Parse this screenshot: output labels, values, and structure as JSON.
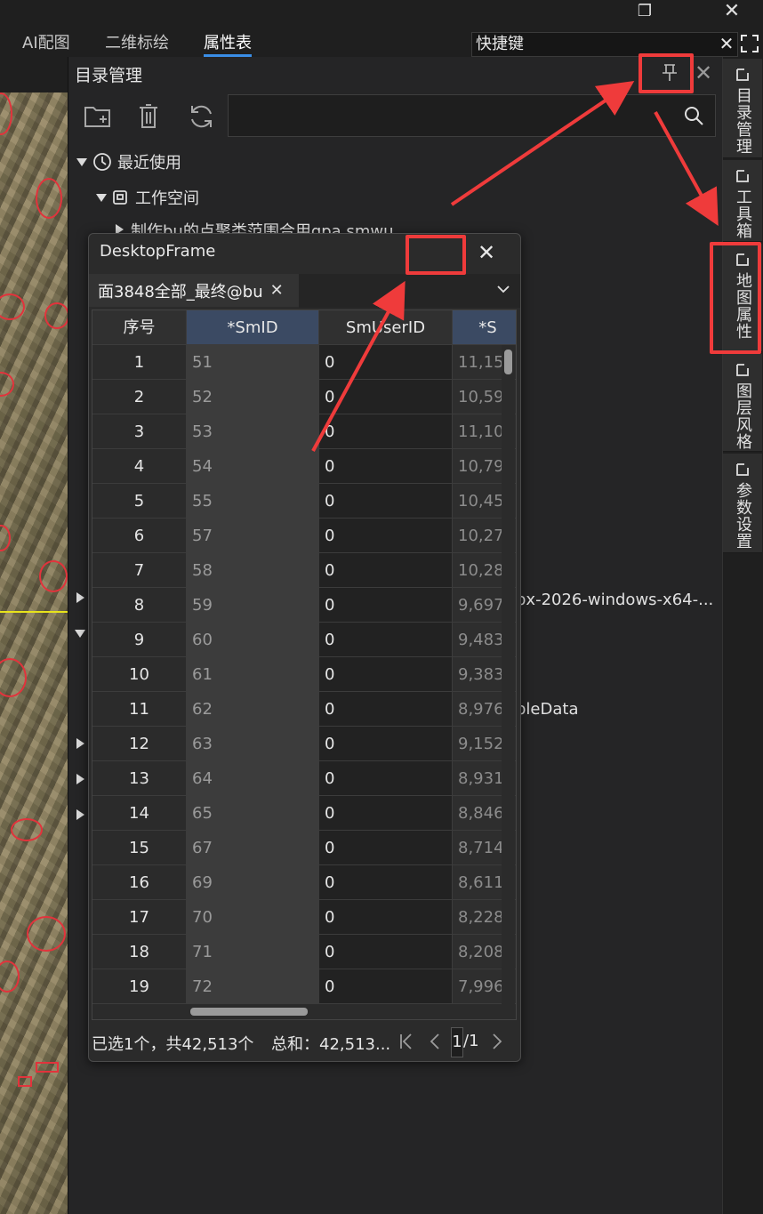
{
  "ribbon": {
    "tabs": [
      "AI配图",
      "二维标绘",
      "属性表"
    ],
    "active_tab": "属性表",
    "shortcut_value": "快捷键",
    "clear_glyph": "✕"
  },
  "window_controls": {
    "restore": "❐",
    "close": "✕"
  },
  "catalog": {
    "title": "目录管理",
    "pin_glyph": "⊤",
    "close_glyph": "✕",
    "tree": [
      {
        "label": "最近使用"
      },
      {
        "label": "工作空间"
      },
      {
        "label": "制作bu的点聚类范围合用gpa.smwu"
      },
      {
        "label": "px-2026-windows-x64-..."
      },
      {
        "label": "bleData"
      }
    ]
  },
  "dock": {
    "tabs": [
      "目录管理",
      "工具箱",
      "地图属性",
      "图层风格",
      "参数设置"
    ]
  },
  "frame": {
    "title": "DesktopFrame",
    "close_glyph": "✕",
    "doc_tab": "面3848全部_最终@bu",
    "doc_tab_close": "✕",
    "columns": [
      "序号",
      "*SmID",
      "SmUserID",
      "*S"
    ],
    "rows": [
      [
        "1",
        "51",
        "0",
        "11,15"
      ],
      [
        "2",
        "52",
        "0",
        "10,59"
      ],
      [
        "3",
        "53",
        "0",
        "11,10"
      ],
      [
        "4",
        "54",
        "0",
        "10,79"
      ],
      [
        "5",
        "55",
        "0",
        "10,45"
      ],
      [
        "6",
        "57",
        "0",
        "10,27"
      ],
      [
        "7",
        "58",
        "0",
        "10,28"
      ],
      [
        "8",
        "59",
        "0",
        "9,697"
      ],
      [
        "9",
        "60",
        "0",
        "9,483"
      ],
      [
        "10",
        "61",
        "0",
        "9,383"
      ],
      [
        "11",
        "62",
        "0",
        "8,976"
      ],
      [
        "12",
        "63",
        "0",
        "9,152"
      ],
      [
        "13",
        "64",
        "0",
        "8,931"
      ],
      [
        "14",
        "65",
        "0",
        "8,846"
      ],
      [
        "15",
        "67",
        "0",
        "8,714"
      ],
      [
        "16",
        "69",
        "0",
        "8,611"
      ],
      [
        "17",
        "70",
        "0",
        "8,228"
      ],
      [
        "18",
        "71",
        "0",
        "8,208"
      ],
      [
        "19",
        "72",
        "0",
        "7,996"
      ]
    ],
    "status": "已选1个，共42,513个",
    "sum": "总和：42,513...",
    "page_current": "1",
    "page_total": "/1"
  },
  "colors": {
    "annotation": "#ef3b3b",
    "accent": "#3a8ee6",
    "panel": "#252526"
  }
}
